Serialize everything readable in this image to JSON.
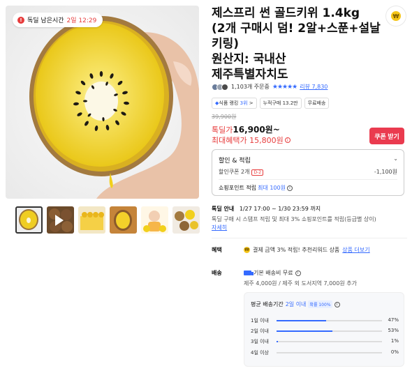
{
  "timer": {
    "label": "독딜 남은시간",
    "time": "2일 12:29"
  },
  "title": "제스프리 썬 골드키위 1.4kg\n(2개 구매시 덤! 2알+스푼+설날 키링)\n원산지: 국내산\n제주특별자치도",
  "title_lines": [
    "제스프리 썬 골드키위 1.4kg",
    "(2개 구매시 덤! 2알+스푼+설날",
    "키링)",
    "원산지: 국내산",
    "제주특별자치도"
  ],
  "rating": {
    "orders": "1,103개 주문중",
    "stars": "★★★★★",
    "review": "리뷰 7,830"
  },
  "chips": [
    {
      "icon": "◆",
      "prefix": "식품 랭킹 ",
      "accent": "3위",
      "suffix": " >"
    },
    {
      "text": "누적구매 13.2만"
    },
    {
      "text": "무료배송"
    }
  ],
  "price": {
    "original": "39,900원",
    "deal_label": "톡딜가",
    "deal_value": "16,900원~",
    "max_label": "최대혜택가 15,800원",
    "coupon_button": "쿠폰 받기"
  },
  "discount": {
    "header": "할인 & 적립",
    "coupon_label": "할인쿠폰 2개",
    "coupon_badge": "D-2",
    "coupon_value": "-1,100원",
    "points_label": "쇼핑포인트 적립 ",
    "points_value": "최대 100원"
  },
  "deal": {
    "label": "톡딜 안내",
    "period": "1/27 17:00 ~ 1/30 23:59 까지",
    "desc": "톡딜 구매 시 스탬프 적립 및 최대 3% 쇼핑포인트를 적립(등급별 상이)",
    "more": "자세히"
  },
  "benefit": {
    "label": "혜택",
    "text": "결제 금액 3% 적립! 추천리워드 상품",
    "link": "상품 더보기"
  },
  "shipping": {
    "label": "배송",
    "value": "기본 배송비 무료",
    "extra": "제주 4,000원 / 제주 외 도서지역 7,000원 추가",
    "avg_label": "평균 배송기간",
    "avg_value": "2일 이내",
    "badge": "확률 100%",
    "distribution": [
      {
        "label": "1일 이내",
        "value": 47,
        "pct": "47%"
      },
      {
        "label": "2일 이내",
        "value": 53,
        "pct": "53%"
      },
      {
        "label": "3일 이내",
        "value": 1,
        "pct": "1%"
      },
      {
        "label": "4일 이상",
        "value": 0,
        "pct": "0%"
      }
    ]
  },
  "colors": {
    "accent_blue": "#346aff",
    "accent_red": "#e73c3c",
    "coupon_red": "#ea3b4f",
    "kiwi_gold": "#f2d01c"
  },
  "icons": [
    "clock-icon",
    "play-icon",
    "coin-icon",
    "info-icon",
    "chevron-down-icon",
    "truck-icon",
    "star-icon"
  ]
}
